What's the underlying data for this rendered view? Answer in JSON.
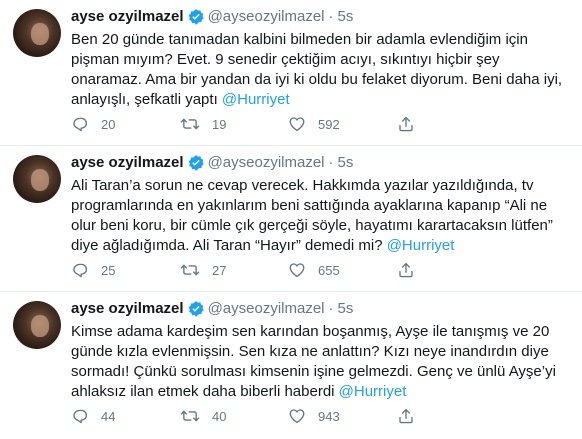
{
  "feed": {
    "tweets": [
      {
        "author_name": "ayse ozyilmazel",
        "handle": "@ayseozyilmazel",
        "separator": "·",
        "time": "5s",
        "text": "Ben 20 günde tanımadan kalbini bilmeden bir adamla evlendiğim için\npişman mıyım? Evet. 9 senedir çektiğim acıyı, sıkıntıyı hiçbir şey\nonaramaz. Ama bir yandan da iyi ki oldu bu felaket diyorum. Beni daha iyi,\nanlayışlı, şefkatli yaptı ",
        "mention": "@Hurriyet",
        "replies": "20",
        "retweets": "19",
        "likes": "592"
      },
      {
        "author_name": "ayse ozyilmazel",
        "handle": "@ayseozyilmazel",
        "separator": "·",
        "time": "5s",
        "text": "Ali Taran’a sorun ne cevap verecek. Hakkımda yazılar yazıldığında, tv\nprogramlarında en yakınlarım beni sattığında ayaklarına kapanıp “Ali ne\nolur beni koru, bir cümle çık gerçeği söyle, hayatımı karartacaksın lütfen”\ndiye ağladığımda. Ali Taran “Hayır” demedi mi? ",
        "mention": "@Hurriyet",
        "replies": "25",
        "retweets": "27",
        "likes": "655"
      },
      {
        "author_name": "ayse ozyilmazel",
        "handle": "@ayseozyilmazel",
        "separator": "·",
        "time": "5s",
        "text": "Kimse adama kardeşim sen karından boşanmış, Ayşe ile tanışmış ve 20\ngünde kızla evlenmişsin. Sen kıza ne anlattın? Kızı neye inandırdın diye\nsormadı! Çünkü sorulması kimsenin işine gelmezdi. Genç ve ünlü Ayşe’yi\nahlaksız ilan etmek daha biberli haberdi ",
        "mention": "@Hurriyet",
        "replies": "44",
        "retweets": "40",
        "likes": "943"
      }
    ]
  },
  "icons": {
    "verified": "verified-badge-icon",
    "reply": "reply-icon",
    "retweet": "retweet-icon",
    "like": "heart-icon",
    "share": "share-icon"
  },
  "colors": {
    "mention": "#1da1f2",
    "verified": "#1da1f2",
    "secondary_text": "#657786",
    "divider": "#e6ecf0"
  }
}
